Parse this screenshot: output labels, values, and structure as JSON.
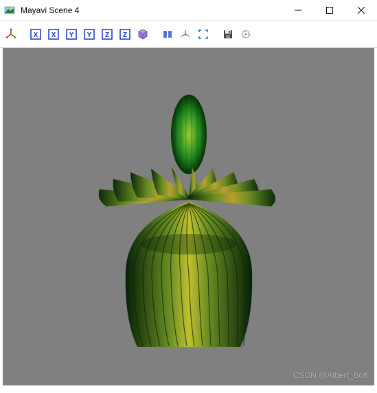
{
  "window": {
    "title": "Mayavi Scene 4"
  },
  "toolbar": {
    "view_buttons": [
      "X",
      "X",
      "Y",
      "Y",
      "Z",
      "Z"
    ]
  },
  "watermark": {
    "text": "CSDN @Albert_Bolt"
  },
  "viewport": {
    "background_color": "#808080"
  }
}
